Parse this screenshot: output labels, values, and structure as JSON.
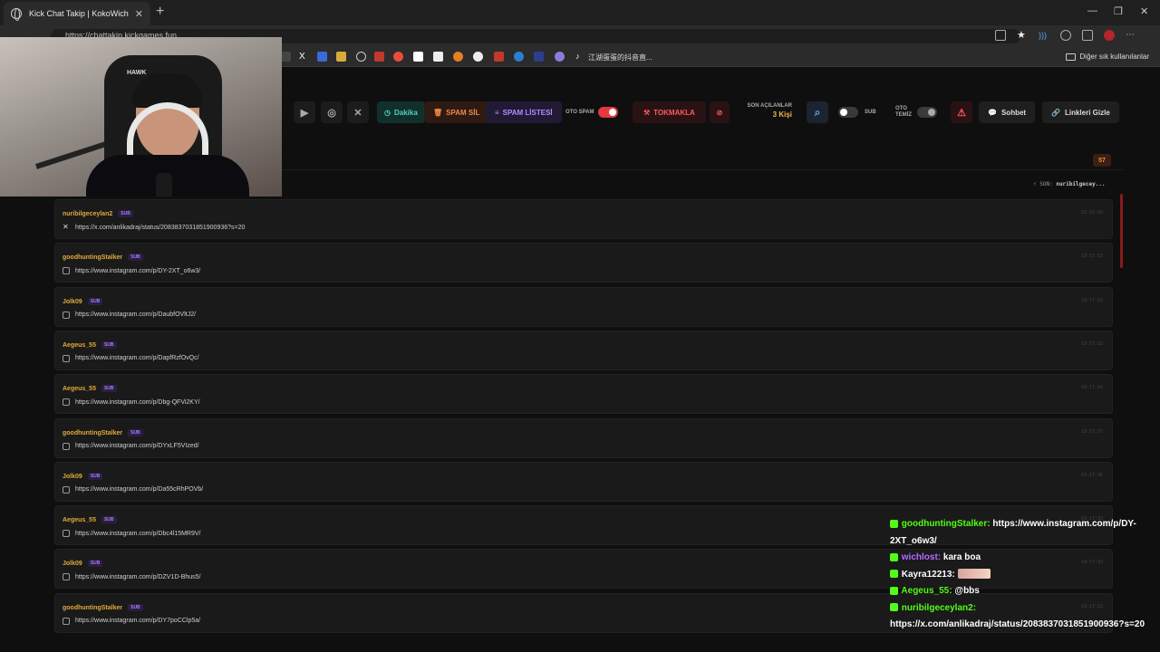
{
  "browser": {
    "tab_title": "Kick Chat Takip | KokoWich",
    "url": "https://chattakip.kickgames.fun",
    "bookmark_text": "江湖蛋蛋的抖音直...",
    "bookmark_other": "Diğer sık kullanılanlar"
  },
  "toolbar": {
    "dakika_label": "Dakika",
    "spam_sil_label": "SPAM SİL",
    "spam_listesi_label": "SPAM LİSTESİ",
    "oto_spam_label": "OTO SPAM",
    "oto_spam_on": true,
    "tokmakla_label": "TOKMAKLA",
    "son_acilanlar_label": "SON AÇILANLAR",
    "son_acilanlar_value": "3 Kişi",
    "sub_label": "SUB",
    "oto_temiz_label": "OTO\nTEMİZ",
    "sohbet_label": "Sohbet",
    "linkleri_gizle_label": "Linkleri Gizle",
    "accent_colors": {
      "dakika": "#4fd1c5",
      "spam_sil": "#f08a4b",
      "spam_listesi": "#b18cff",
      "tokmakla": "#ff5a5f"
    }
  },
  "feed": {
    "count": "57",
    "son_label": "SON:",
    "son_user": "nuribilgecey...",
    "messages": [
      {
        "user": "nuribilgeceylan2",
        "badge": "SUB",
        "platform": "x",
        "url": "https://x.com/anlikadraj/status/2083837031851900936?s=20",
        "time": "33:10:05"
      },
      {
        "user": "goodhuntingStalker",
        "badge": "SUB",
        "platform": "instagram",
        "url": "https://www.instagram.com/p/DY-2XT_o6w3/",
        "time": "19:17:52"
      },
      {
        "user": "Jolk09",
        "badge": "SUB",
        "platform": "instagram",
        "url": "https://www.instagram.com/p/DaubfOVltJ2/",
        "time": "19:17:52"
      },
      {
        "user": "Aegeus_55",
        "badge": "SUB",
        "platform": "instagram",
        "url": "https://www.instagram.com/p/DapfRzfOvQc/",
        "time": "19:17:32"
      },
      {
        "user": "Aegeus_55",
        "badge": "SUB",
        "platform": "instagram",
        "url": "https://www.instagram.com/p/Dbg-QFVi2KY/",
        "time": "19:17:41"
      },
      {
        "user": "goodhuntingStalker",
        "badge": "SUB",
        "platform": "instagram",
        "url": "https://www.instagram.com/p/DYxLF5VIzed/",
        "time": "19:17:37"
      },
      {
        "user": "Jolk09",
        "badge": "SUB",
        "platform": "instagram",
        "url": "https://www.instagram.com/p/Da55cRhPOVb/",
        "time": "19:17:36"
      },
      {
        "user": "Aegeus_55",
        "badge": "SUB",
        "platform": "instagram",
        "url": "https://www.instagram.com/p/Dbc4l15MR9V/",
        "time": "19:17:33"
      },
      {
        "user": "Jolk09",
        "badge": "SUB",
        "platform": "instagram",
        "url": "https://www.instagram.com/p/DZV1D-Bhus5/",
        "time": "19:17:33"
      },
      {
        "user": "goodhuntingStalker",
        "badge": "SUB",
        "platform": "instagram",
        "url": "https://www.instagram.com/p/DY7poCClp5a/",
        "time": "19:17:12"
      }
    ]
  },
  "webcam": {
    "chair_brand": "HAWK"
  },
  "chat_overlay": {
    "lines": [
      {
        "name": "goodhuntingStalker:",
        "text": " https://www.instagram.com/p/DY-2XT_o6w3/",
        "color": "green"
      },
      {
        "name": "wichlost:",
        "text": " kara boa",
        "color": "purple"
      },
      {
        "name": "Kayra12213:",
        "text": " ",
        "color": "white",
        "emote": true
      },
      {
        "name": "Aegeus_55:",
        "text": " @bbs",
        "color": "green"
      },
      {
        "name": "nuribilgeceylan2:",
        "text": " https://x.com/anlikadraj/status/2083837031851900936?s=20",
        "color": "green"
      }
    ]
  }
}
